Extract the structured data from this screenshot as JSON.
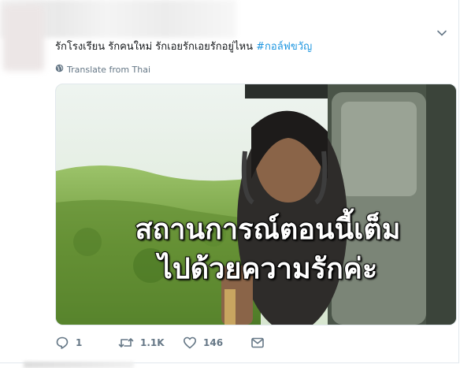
{
  "tweet": {
    "text": "รักโรงเรียน รักคนใหม่ รักเอยรักเอยรักอยู่ไหน",
    "hashtag": "#กอล์ฟขวัญ",
    "translate_label": "Translate from Thai"
  },
  "media": {
    "caption_line1": "สถานการณ์ตอนนี้เต็ม",
    "caption_line2": "ไปด้วยความรักค่ะ"
  },
  "actions": {
    "reply_count": "1",
    "retweet_count": "1.1K",
    "like_count": "146"
  },
  "icons": {
    "caret": "chevron-down-icon",
    "globe": "globe-icon",
    "reply": "reply-icon",
    "retweet": "retweet-icon",
    "like": "heart-icon",
    "message": "envelope-icon"
  },
  "colors": {
    "text": "#14171a",
    "secondary": "#657786",
    "hashtag": "#1b95e0",
    "border": "#e1e8ed"
  }
}
